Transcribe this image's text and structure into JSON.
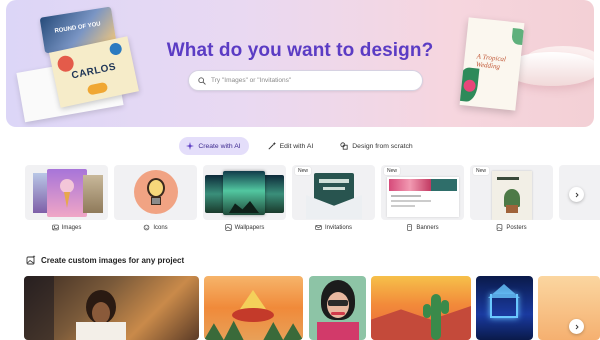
{
  "hero": {
    "title": "What do you want to design?",
    "search_placeholder": "Try \"Images\" or \"Invitations\"",
    "decor": {
      "card_text": "ROUND OF YOU",
      "invite_text": "CARLOS",
      "wedding_text": "A Tropical Wedding"
    }
  },
  "tabs": [
    {
      "label": "Create with AI",
      "icon": "sparkle-icon",
      "active": true
    },
    {
      "label": "Edit with AI",
      "icon": "wand-icon",
      "active": false
    },
    {
      "label": "Design from scratch",
      "icon": "design-icon",
      "active": false
    }
  ],
  "categories": [
    {
      "label": "Images",
      "icon": "image-icon",
      "new": false
    },
    {
      "label": "Icons",
      "icon": "icons-icon",
      "new": false
    },
    {
      "label": "Wallpapers",
      "icon": "wallpaper-icon",
      "new": false
    },
    {
      "label": "Invitations",
      "icon": "invitation-icon",
      "new": true,
      "badge": "New"
    },
    {
      "label": "Banners",
      "icon": "banner-icon",
      "new": true,
      "badge": "New"
    },
    {
      "label": "Posters",
      "icon": "poster-icon",
      "new": true,
      "badge": "New"
    }
  ],
  "section": {
    "title": "Create custom images for any project",
    "icon": "image-sparkle-icon"
  },
  "colors": {
    "accent": "#5b3cc4",
    "chip_active_bg": "#e4defa"
  }
}
